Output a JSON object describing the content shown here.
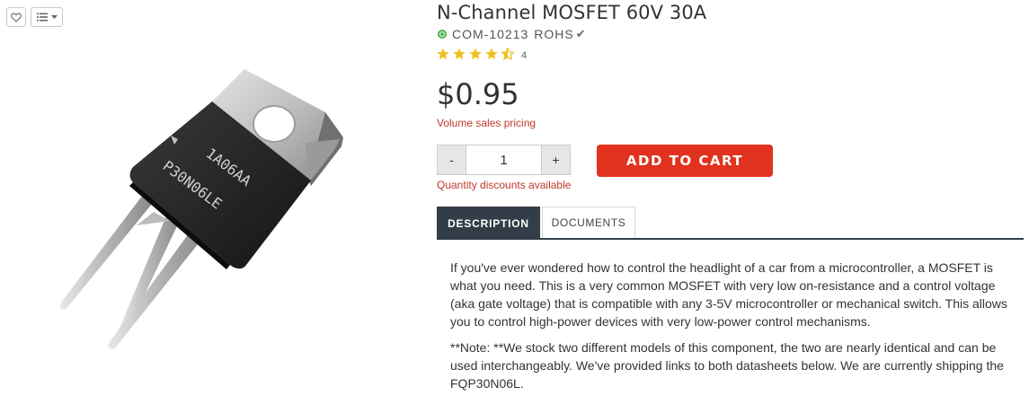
{
  "product": {
    "title": "N-Channel MOSFET 60V 30A",
    "sku": "COM-10213",
    "compliance": "ROHS",
    "rating_stars": 4.5,
    "review_count": "4",
    "price": "$0.95",
    "volume_pricing": "Volume sales pricing"
  },
  "purchase": {
    "decrement_label": "-",
    "increment_label": "+",
    "quantity": "1",
    "discount_note": "Quantity discounts available",
    "add_to_cart": "ADD TO CART"
  },
  "image_marking": {
    "line1": "1A06AA",
    "line2": "P30N06LE"
  },
  "tabs": [
    {
      "label": "DESCRIPTION",
      "active": true
    },
    {
      "label": "DOCUMENTS",
      "active": false
    }
  ],
  "description": {
    "paragraph1": "If you've ever wondered how to control the headlight of a car from a microcontroller, a MOSFET is what you need. This is a very common MOSFET with very low on-resistance and a control voltage (aka gate voltage) that is compatible with any 3-5V microcontroller or mechanical switch. This allows you to control high-power devices with very low-power control mechanisms.",
    "paragraph2": "**Note: **We stock two different models of this component, the two are nearly identical and can be used interchangeably. We've provided links to both datasheets below. We are currently shipping the FQP30N06L."
  },
  "colors": {
    "accent_red": "#e0321e",
    "link_red": "#c0392b",
    "tab_dark": "#333d47",
    "star_gold": "#f0c020",
    "status_green": "#4caf50"
  },
  "icons": [
    "heart-icon",
    "list-icon",
    "chevron-down-icon",
    "status-dot-icon",
    "check-icon",
    "star-icon",
    "half-star-icon"
  ]
}
